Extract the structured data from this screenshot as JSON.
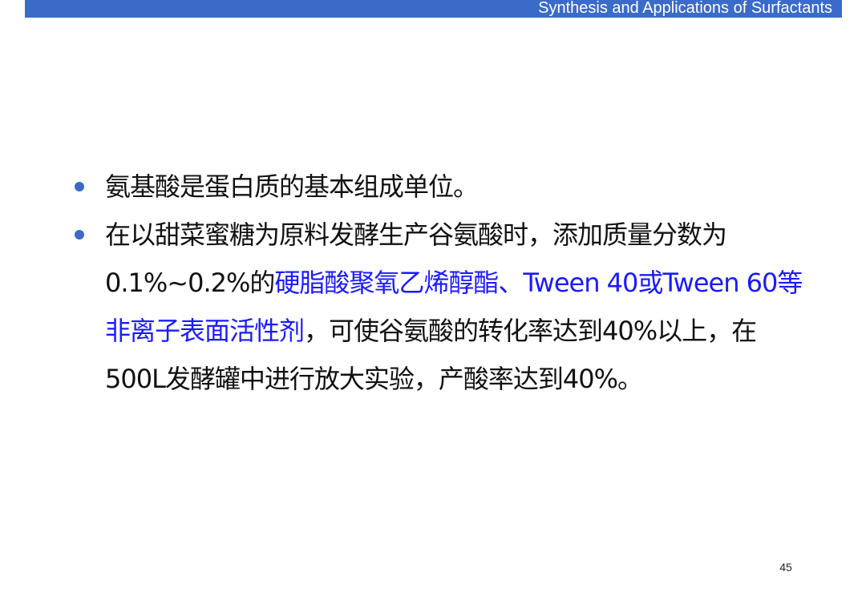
{
  "header": {
    "title": "Synthesis and Applications of Surfactants"
  },
  "bullets": [
    {
      "text": "氨基酸是蛋白质的基本组成单位。"
    },
    {
      "part1": "在以甜菜蜜糖为原料发酵生产谷氨酸时，添加质量分数为0.1%~0.2%的",
      "highlight": "硬脂酸聚氧乙烯醇酯、Tween  40或Tween 60等非离子表面活性剂",
      "part2": "，可使谷氨酸的转化率达到40%以上，在500L发酵罐中进行放大实验，产酸率达到40%。"
    }
  ],
  "colors": {
    "accent": "#3a6bc9",
    "highlight": "#1a1aff",
    "text": "#111111"
  },
  "footer": {
    "page_number": "45"
  }
}
